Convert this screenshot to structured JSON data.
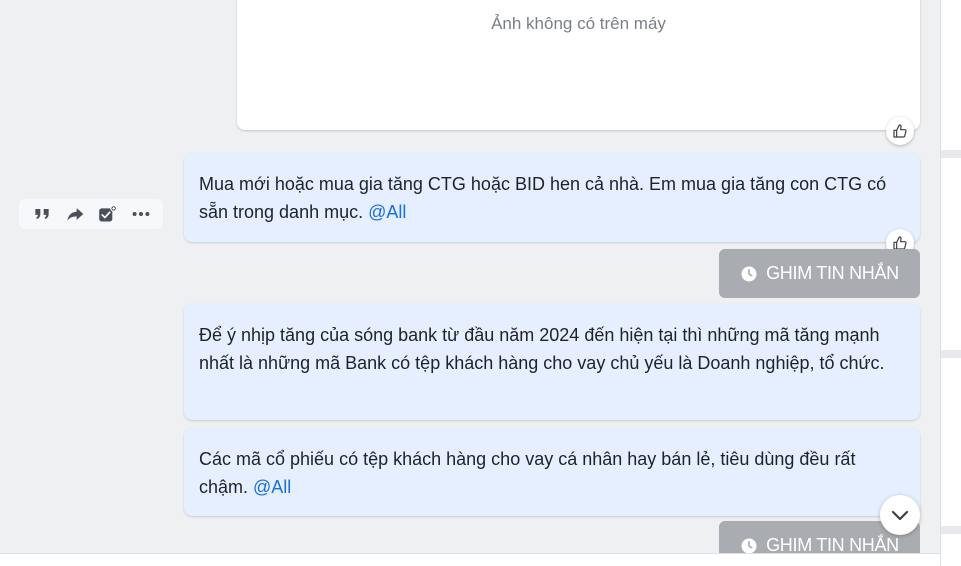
{
  "image_message": {
    "placeholder": "Ảnh không có trên máy"
  },
  "messages": [
    {
      "parts": [
        "Mua mới hoặc mua gia tăng CTG hoặc BID hen cả nhà. Em mua gia tăng con CTG có sẵn trong danh mục. "
      ],
      "mention": "@All"
    },
    {
      "parts": [
        "Để ý nhịp tăng của sóng bank từ đầu năm 2024 đến hiện tại thì những mã tăng mạnh nhất là những mã Bank có tệp khách hàng cho vay chủ yếu là Doanh nghiệp, tổ chức."
      ]
    },
    {
      "parts": [
        "Các mã cổ phiếu có tệp khách hàng cho vay cá nhân hay bán lẻ, tiêu dùng đều rất chậm. "
      ],
      "mention": "@All"
    }
  ],
  "pin_button": {
    "label": "GHIM TIN NHẮN"
  },
  "icons": {
    "reaction": "thumbs-up-icon",
    "pin": "clock-icon",
    "quote": "quote-icon",
    "forward": "forward-icon",
    "task": "task-check-icon",
    "more": "more-icon",
    "scroll": "chevron-down-icon"
  },
  "colors": {
    "bubble": "#e5efff",
    "mention": "#1a6fd8",
    "pin_button": "#a9acb0",
    "chat_background": "#eef0f1"
  }
}
